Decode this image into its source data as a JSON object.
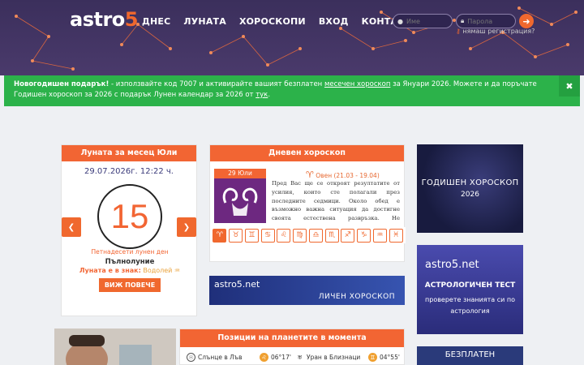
{
  "header": {
    "logo_text": "astro",
    "logo_accent": "5",
    "nav": [
      "ДНЕС",
      "ЛУНАТА",
      "ХОРОСКОПИ",
      "ВХОД",
      "КОНТАКТИ"
    ],
    "username_placeholder": "Име",
    "password_placeholder": "Парола",
    "register_link": "нямаш регистрация?"
  },
  "promo": {
    "bold": "Новогодишен подарък!",
    "part1": " - използвайте код 7007 и активирайте вашият безплатен ",
    "link1": "месечен хороскоп",
    "part2": " за Януари 2026. Можете и да поръчате Годишен хороскоп за 2026 с подарък Лунен календар за 2026 от ",
    "link2": "тук",
    "part3": ".",
    "close": "✖"
  },
  "moon": {
    "title": "Луната за месец Юли",
    "date": "29.07.2026г. 12:22 ч.",
    "day_number": "15",
    "day_name": "Петнадесети лунен ден",
    "phase": "Пълнолуние",
    "sign_label": "Луната е в знак:",
    "sign_value": "Водолей ♒",
    "more_button": "ВИЖ ПОВЕЧЕ",
    "prev": "❮",
    "next": "❯"
  },
  "daily": {
    "title": "Дневен хороскоп",
    "date_label": "29 Юли",
    "sign_symbol": "♈",
    "sign_name": " Овен (21.03 - 19.04)",
    "text": "Пред Вас ще се откроят резултатите от усилия, които сте полагали през последните седмици. Около обед е възможно важна ситуация да достигне своята естествена развръзка. Не позволявайте на прекалено силните емоции да попречат на преценката Ви. В края на деня",
    "zodiac": [
      "♈",
      "♉",
      "♊",
      "♋",
      "♌",
      "♍",
      "♎",
      "♏",
      "♐",
      "♑",
      "♒",
      "♓"
    ]
  },
  "banner_personal": {
    "left": "astro5.net",
    "right": "ЛИЧЕН ХОРОСКОП"
  },
  "ads": {
    "ad1_line1": "ГОДИШЕН ХОРОСКОП",
    "ad1_line2": "2026",
    "ad2_logo": "astro5.net",
    "ad2_title": "АСТРОЛОГИЧЕН ТЕСТ",
    "ad2_sub": "проверете знанията си по астрология",
    "ad3_text": "БЕЗПЛАТЕН"
  },
  "planets": {
    "title": "Позиции на планетите в момента",
    "rows": [
      {
        "icon": "☉",
        "name": "Слънце в Лъв",
        "deg": "06°17'"
      },
      {
        "icon": "♅",
        "name": "Уран в Близнаци",
        "deg": "04°55'"
      }
    ]
  }
}
